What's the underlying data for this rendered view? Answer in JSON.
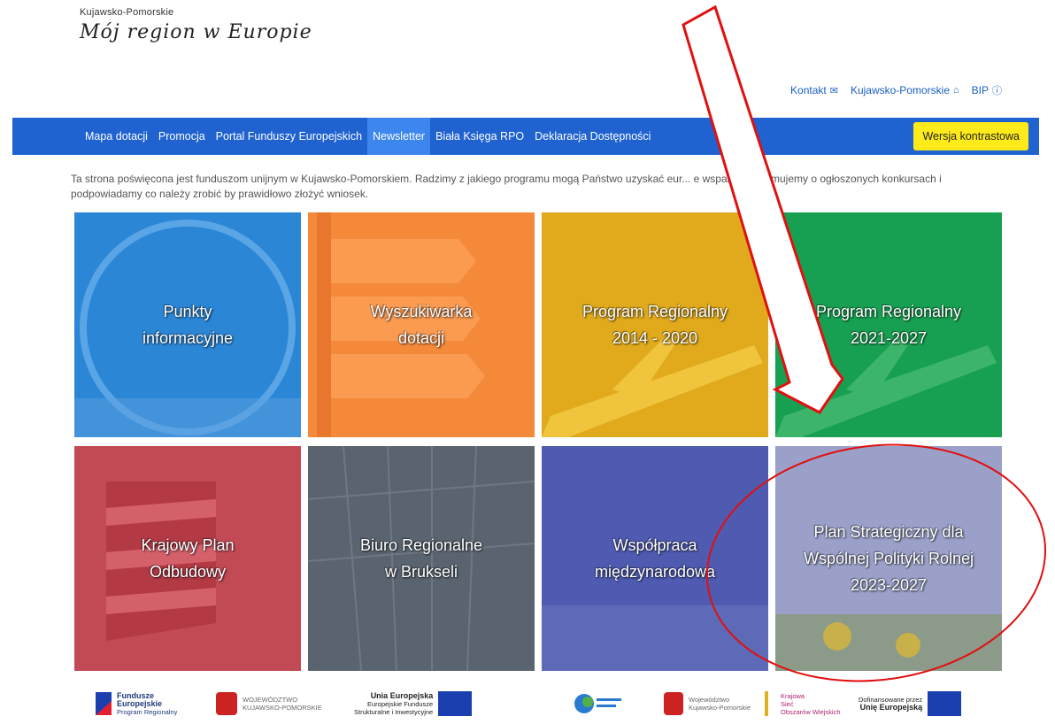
{
  "brand": {
    "region": "Kujawsko-Pomorskie",
    "tagline": "Mój region w Europie"
  },
  "top_links": [
    {
      "label": "Kontakt",
      "icon": "envelope-icon"
    },
    {
      "label": "Kujawsko-Pomorskie",
      "icon": "home-icon"
    },
    {
      "label": "BIP",
      "icon": "info-icon"
    }
  ],
  "nav": {
    "items": [
      {
        "label": "Mapa dotacji"
      },
      {
        "label": "Promocja"
      },
      {
        "label": "Portal Funduszy Europejskich"
      },
      {
        "label": "Newsletter",
        "active": true
      },
      {
        "label": "Biała Księga RPO"
      },
      {
        "label": "Deklaracja Dostępności"
      }
    ],
    "contrast_button": "Wersja kontrastowa"
  },
  "intro": "Ta strona poświęcona jest funduszom unijnym w Kujawsko-Pomorskiem. Radzimy z jakiego programu mogą Państwo uzyskać eur... e wsparcie, informujemy o ogłoszonych konkursach i podpowiadamy co należy zrobić by prawidłowo złożyć wniosek.",
  "tiles": [
    {
      "label": "Punkty\ninformacyjne",
      "color": "#2b86d6"
    },
    {
      "label": "Wyszukiwarka\ndotacji",
      "color": "#f5893a"
    },
    {
      "label": "Program Regionalny\n2014 - 2020",
      "color": "#e0aa1c"
    },
    {
      "label": "Program Regionalny\n2021-2027",
      "color": "#18a052"
    },
    {
      "label": "Krajowy Plan\nOdbudowy",
      "color": "#c24a55"
    },
    {
      "label": "Biuro Regionalne\nw Brukseli",
      "color": "#5a6470"
    },
    {
      "label": "Współpraca\nmiędzynarodowa",
      "color": "#4e5bb0"
    },
    {
      "label": "Plan Strategiczny dla\nWspólnej Polityki Rolnej\n2023-2027",
      "color": "#9aa0c8"
    }
  ],
  "footer_logos": [
    {
      "line1": "Fundusze",
      "line2": "Europejskie",
      "line3": "Program Regionalny"
    },
    {
      "line1": "WOJEWÓDZTWO",
      "line2": "KUJAWSKO-POMORSKIE"
    },
    {
      "line1": "Unia Europejska",
      "line2": "Europejskie Fundusze",
      "line3": "Strukturalne i Inwestycyjne"
    },
    {
      "line1": "",
      "line2": ""
    },
    {
      "line1": "Województwo",
      "line2": "Kujawsko-Pomorskie"
    },
    {
      "line1": "Krajowa",
      "line2": "Sieć",
      "line3": "Obszarów Wiejskich"
    },
    {
      "line1": "Dofinansowane przez",
      "line2": "Unię Europejską"
    }
  ],
  "colors": {
    "nav": "#1f62d0",
    "nav_active": "#3d86ee",
    "contrast": "#ffeb1a",
    "annotation": "#e01010"
  }
}
